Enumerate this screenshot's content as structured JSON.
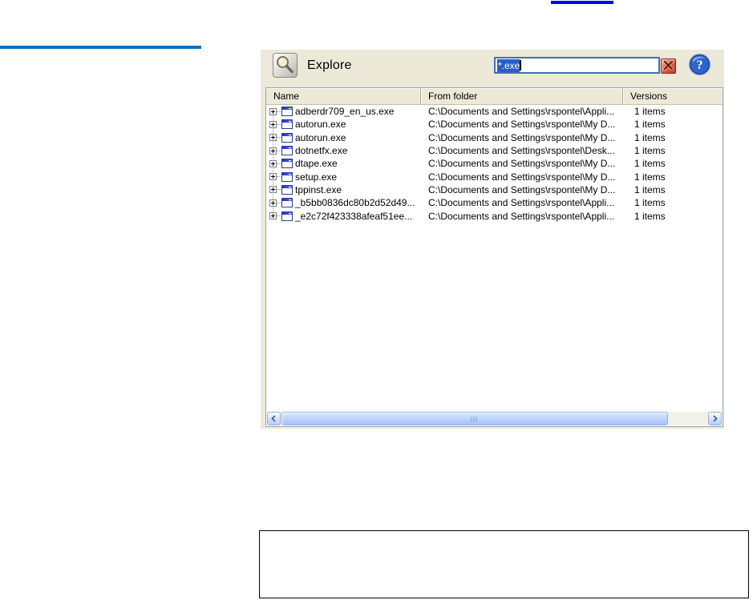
{
  "decor": {
    "top_link_fragment_color": "#0404ee",
    "left_rule_color": "#1070b8"
  },
  "panel": {
    "title": "Explore",
    "search": {
      "value": "*.exe",
      "selection_color": "#2e5bcb"
    },
    "help_glyph": "?"
  },
  "list": {
    "columns": {
      "name": "Name",
      "folder": "From folder",
      "versions": "Versions"
    },
    "rows": [
      {
        "name": "adberdr709_en_us.exe",
        "folder": "C:\\Documents and Settings\\rspontel\\Appli...",
        "versions": "1 items"
      },
      {
        "name": "autorun.exe",
        "folder": "C:\\Documents and Settings\\rspontel\\My D...",
        "versions": "1 items"
      },
      {
        "name": "autorun.exe",
        "folder": "C:\\Documents and Settings\\rspontel\\My D...",
        "versions": "1 items"
      },
      {
        "name": "dotnetfx.exe",
        "folder": "C:\\Documents and Settings\\rspontel\\Desk...",
        "versions": "1 items"
      },
      {
        "name": "dtape.exe",
        "folder": "C:\\Documents and Settings\\rspontel\\My D...",
        "versions": "1 items"
      },
      {
        "name": "setup.exe",
        "folder": "C:\\Documents and Settings\\rspontel\\My D...",
        "versions": "1 items"
      },
      {
        "name": "tppinst.exe",
        "folder": "C:\\Documents and Settings\\rspontel\\My D...",
        "versions": "1 items"
      },
      {
        "name": "_b5bb0836dc80b2d52d49...",
        "folder": "C:\\Documents and Settings\\rspontel\\Appli...",
        "versions": "1 items"
      },
      {
        "name": "_e2c72f423338afeaf51ee...",
        "folder": "C:\\Documents and Settings\\rspontel\\Appli...",
        "versions": "1 items"
      }
    ]
  }
}
